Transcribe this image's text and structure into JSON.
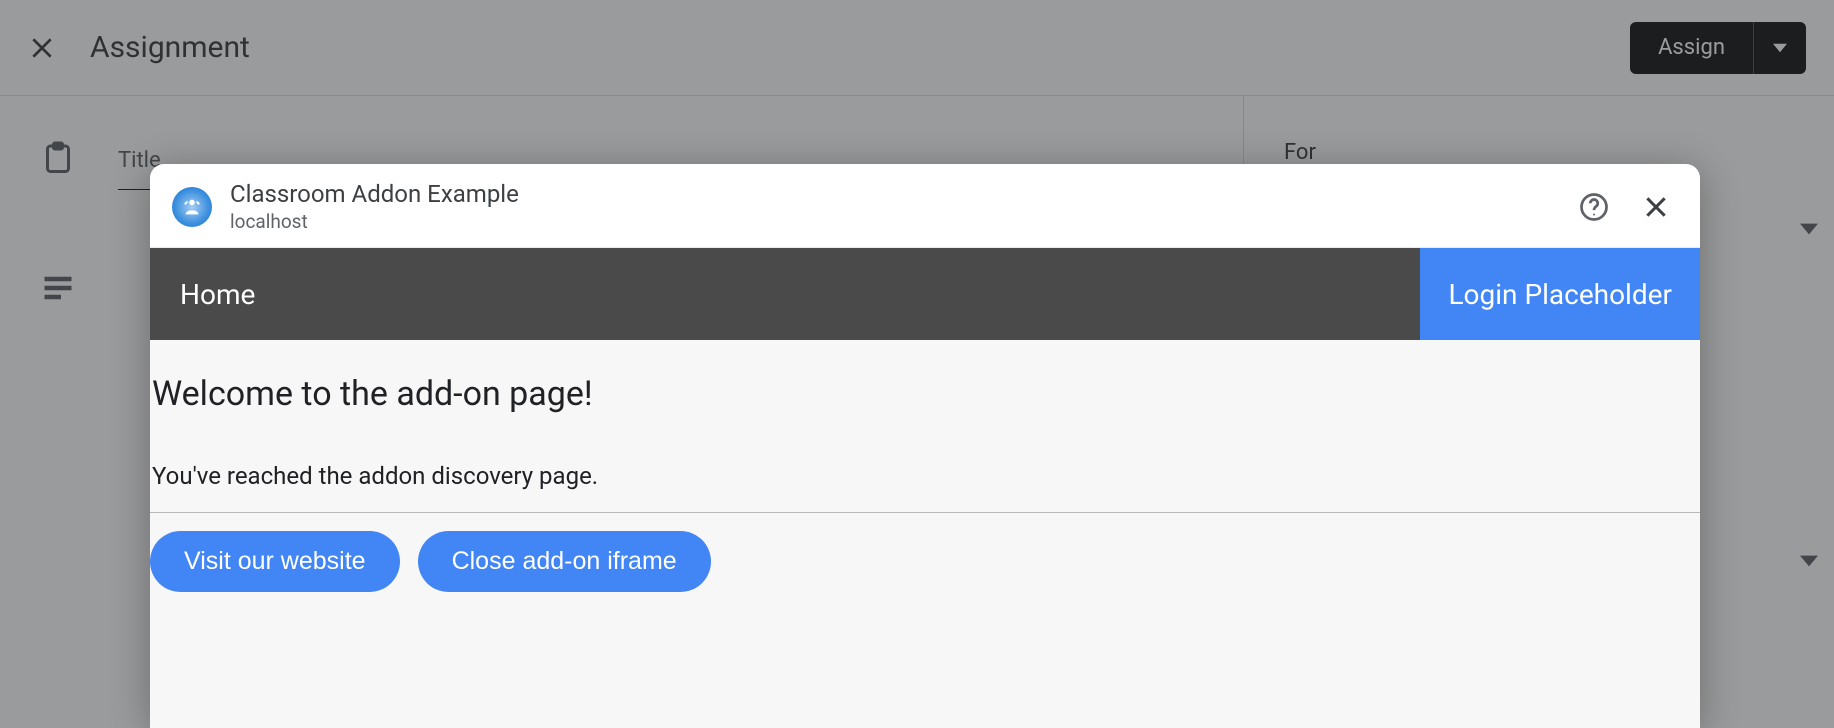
{
  "header": {
    "title": "Assignment",
    "assign_label": "Assign"
  },
  "background": {
    "title_field_label": "Title",
    "for_label": "For"
  },
  "dialog": {
    "title": "Classroom Addon Example",
    "subtitle": "localhost"
  },
  "addon": {
    "nav_home": "Home",
    "nav_login": "Login Placeholder",
    "heading": "Welcome to the add-on page!",
    "subtext": "You've reached the addon discovery page.",
    "buttons": {
      "visit": "Visit our website",
      "close": "Close add-on iframe"
    }
  }
}
